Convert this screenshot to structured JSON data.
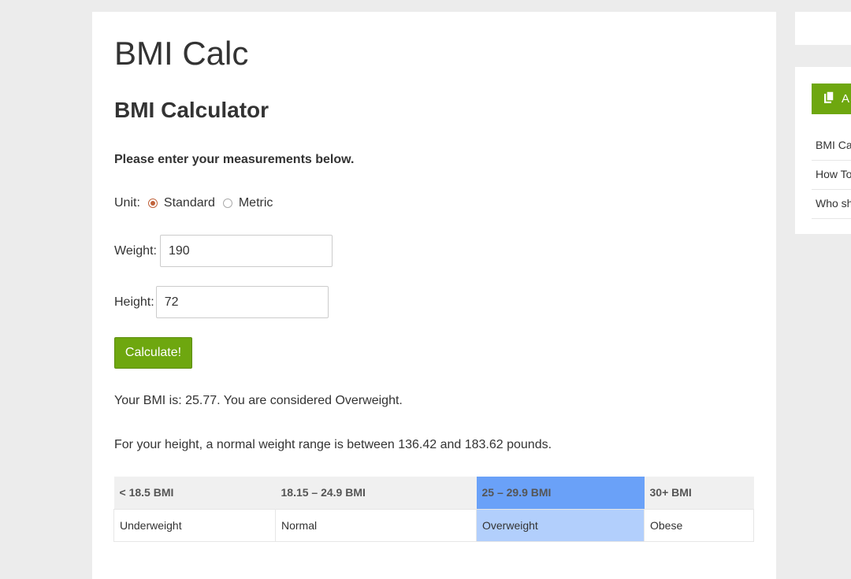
{
  "site": {
    "title": "BMI Calc"
  },
  "page": {
    "heading": "BMI Calculator",
    "instructions": "Please enter your measurements below."
  },
  "form": {
    "unit_label": "Unit:",
    "unit_options": [
      {
        "label": "Standard",
        "selected": true
      },
      {
        "label": "Metric",
        "selected": false
      }
    ],
    "weight_label": "Weight:",
    "weight_value": "190",
    "height_label": "Height:",
    "height_value": "72",
    "submit_label": "Calculate!"
  },
  "results": {
    "bmi_text": "Your BMI is: 25.77. You are considered Overweight.",
    "range_text": "For your height, a normal weight range is between 136.42 and 183.62 pounds."
  },
  "bmi_table": {
    "headers": [
      "< 18.5 BMI",
      "18.15 – 24.9 BMI",
      "25 – 29.9 BMI",
      "30+ BMI"
    ],
    "categories": [
      "Underweight",
      "Normal",
      "Overweight",
      "Obese"
    ],
    "highlighted_index": 2
  },
  "sidebar": {
    "widget_title": "A",
    "items": [
      "BMI Ca",
      "How To",
      "Who sh"
    ]
  },
  "colors": {
    "accent_green": "#6ea70f",
    "highlight_header": "#6aa1f8",
    "highlight_cell": "#b2cffc",
    "radio_checked": "#c0623a"
  },
  "icons": {
    "widget_icon": "document-copy-icon"
  }
}
